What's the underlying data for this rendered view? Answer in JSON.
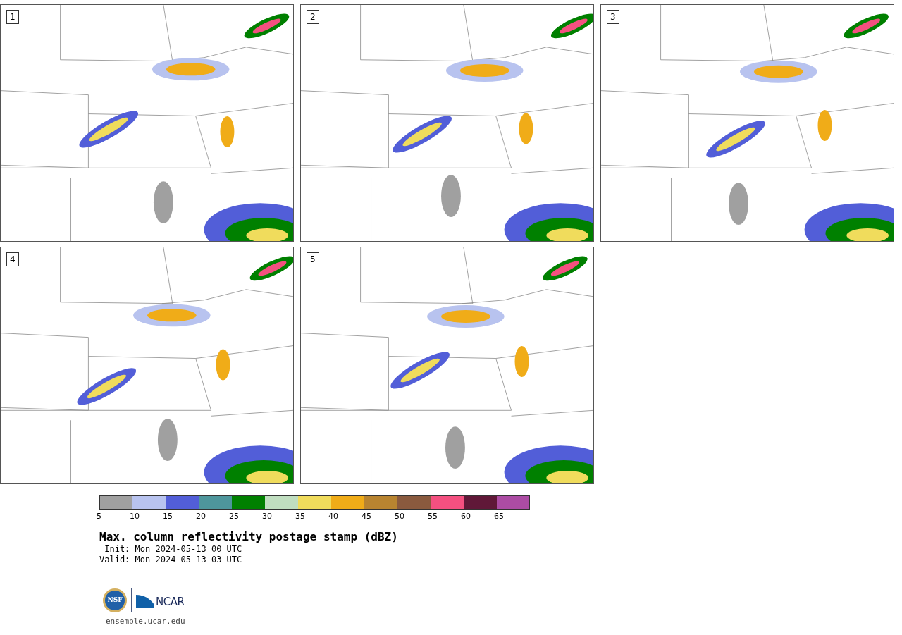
{
  "panels": [
    {
      "number": "1"
    },
    {
      "number": "2"
    },
    {
      "number": "3"
    },
    {
      "number": "4"
    },
    {
      "number": "5"
    }
  ],
  "colorbar": [
    {
      "label": "5",
      "color": "#a0a0a0"
    },
    {
      "label": "10",
      "color": "#b8c3ef"
    },
    {
      "label": "15",
      "color": "#525ed8"
    },
    {
      "label": "20",
      "color": "#4e969c"
    },
    {
      "label": "25",
      "color": "#008000"
    },
    {
      "label": "30",
      "color": "#c0dec0"
    },
    {
      "label": "35",
      "color": "#f0dc5c"
    },
    {
      "label": "40",
      "color": "#f0ac18"
    },
    {
      "label": "45",
      "color": "#b88430"
    },
    {
      "label": "50",
      "color": "#8a5a3e"
    },
    {
      "label": "55",
      "color": "#f45080"
    },
    {
      "label": "60",
      "color": "#601838"
    },
    {
      "label": "65",
      "color": "#ac4ca4"
    }
  ],
  "title": "Max. column reflectivity postage stamp (dBZ)",
  "init": "Init: Mon 2024-05-13 00 UTC",
  "valid": "Valid: Mon 2024-05-13 03 UTC",
  "logos": {
    "nsf": "NSF",
    "ncar": "NCAR"
  },
  "url": "ensemble.ucar.edu"
}
